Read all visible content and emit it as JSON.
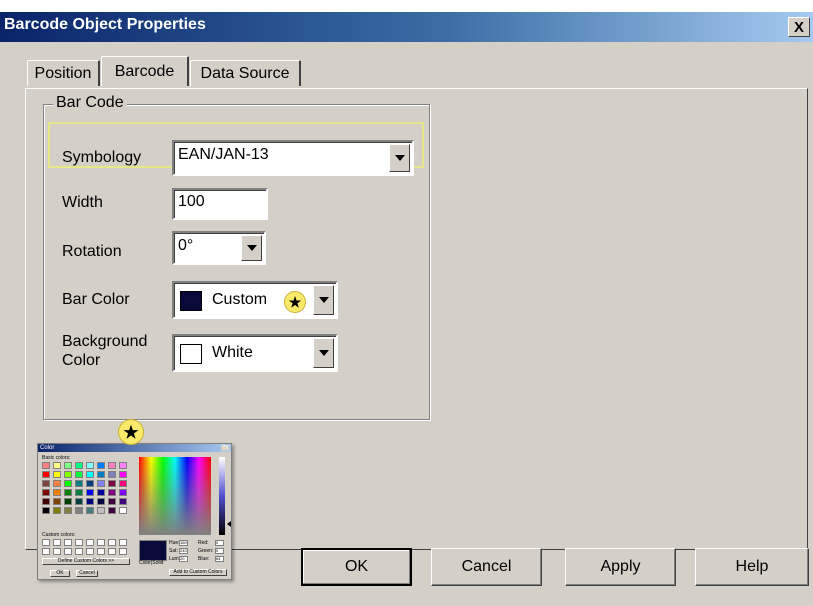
{
  "window": {
    "title": "Barcode Object Properties",
    "close_glyph": "X"
  },
  "tabs": [
    {
      "label": "Position",
      "active": false
    },
    {
      "label": "Barcode",
      "active": true
    },
    {
      "label": "Data Source",
      "active": false
    }
  ],
  "barcode_group": {
    "title": "Bar Code",
    "symbology": {
      "label": "Symbology",
      "value": "EAN/JAN-13"
    },
    "width": {
      "label": "Width",
      "value": "100"
    },
    "rotation": {
      "label": "Rotation",
      "value": "0°"
    },
    "bar_color": {
      "label": "Bar Color",
      "value": "Custom",
      "swatch": "#0a0a3a",
      "badge_icon": "star-icon"
    },
    "background_color": {
      "label_line1": "Background",
      "label_line2": "Color",
      "value": "White",
      "swatch": "#ffffff"
    }
  },
  "color_dialog_thumbnail": {
    "title": "Color",
    "close_glyph": "?x",
    "basic_colors_label": "Basic colors:",
    "custom_colors_label": "Custom colors:",
    "define_button": "Define Custom Colors >>",
    "ok_button": "OK",
    "cancel_button": "Cancel",
    "color_solid_label": "Color|Solid",
    "hue_label": "Hue:",
    "hue_value": "160",
    "sat_label": "Sat:",
    "sat_value": "240",
    "lum_label": "Lum:",
    "lum_value": "20",
    "red_label": "Red:",
    "red_value": "0",
    "green_label": "Green:",
    "green_value": "0",
    "blue_label": "Blue:",
    "blue_value": "64",
    "add_button": "Add to Custom Colors",
    "basic_colors": [
      "#ff8080",
      "#ffff80",
      "#80ff80",
      "#00ff80",
      "#80ffff",
      "#0080ff",
      "#ff80c0",
      "#ff80ff",
      "#ff0000",
      "#ffff00",
      "#80ff00",
      "#00ff40",
      "#00ffff",
      "#0080c0",
      "#8080c0",
      "#ff00ff",
      "#804040",
      "#ff8040",
      "#00ff00",
      "#008080",
      "#004080",
      "#8080ff",
      "#800040",
      "#ff0080",
      "#800000",
      "#ff8000",
      "#008000",
      "#008040",
      "#0000ff",
      "#0000a0",
      "#800080",
      "#8000ff",
      "#400000",
      "#804000",
      "#004000",
      "#004040",
      "#000080",
      "#000040",
      "#400040",
      "#400080",
      "#000000",
      "#808000",
      "#808040",
      "#808080",
      "#408080",
      "#c0c0c0",
      "#400040",
      "#ffffff"
    ],
    "badge_icon": "star-icon"
  },
  "buttons": {
    "ok": "OK",
    "cancel": "Cancel",
    "apply": "Apply",
    "help": "Help"
  },
  "colors": {
    "highlight_outline": "#e8e68a",
    "badge_fill": "#fbe96a",
    "titlebar_start": "#0a246a"
  }
}
